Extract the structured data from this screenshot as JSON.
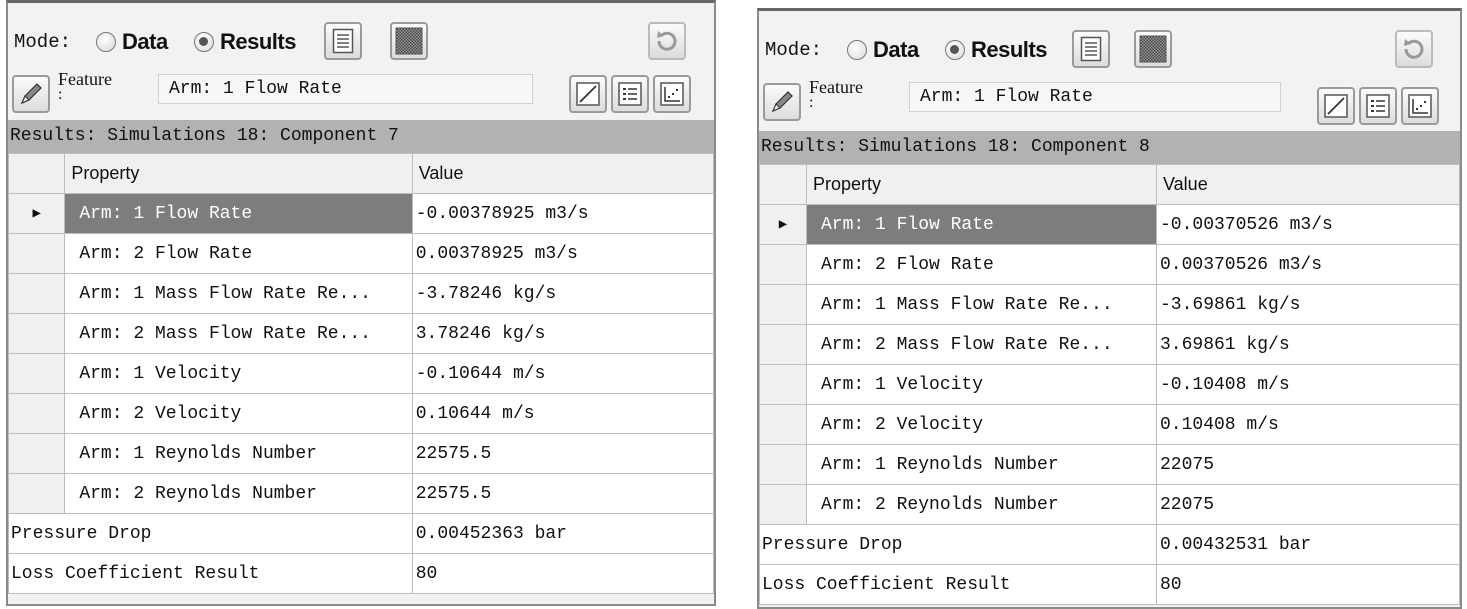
{
  "panels": [
    {
      "mode_label": "Mode:",
      "radio_data": "Data",
      "radio_results": "Results",
      "feature_label": "Feature",
      "feature_colon": ":",
      "feature_value": "Arm: 1 Flow Rate",
      "results_header": "Results: Simulations 18: Component 7",
      "col_property": "Property",
      "col_value": "Value",
      "rows": [
        {
          "property": "Arm: 1 Flow Rate",
          "value": "-0.00378925 m3/s"
        },
        {
          "property": "Arm: 2 Flow Rate",
          "value": "0.00378925 m3/s"
        },
        {
          "property": "Arm: 1 Mass Flow Rate Re...",
          "value": "-3.78246 kg/s"
        },
        {
          "property": "Arm: 2 Mass Flow Rate Re...",
          "value": "3.78246 kg/s"
        },
        {
          "property": "Arm: 1 Velocity",
          "value": "-0.10644 m/s"
        },
        {
          "property": "Arm: 2 Velocity",
          "value": "0.10644 m/s"
        },
        {
          "property": "Arm: 1 Reynolds Number",
          "value": "22575.5"
        },
        {
          "property": "Arm: 2 Reynolds Number",
          "value": "22575.5"
        }
      ],
      "extra_rows": [
        {
          "property": "Pressure Drop",
          "value": "0.00452363 bar"
        },
        {
          "property": "Loss Coefficient Result",
          "value": "80"
        }
      ]
    },
    {
      "mode_label": "Mode:",
      "radio_data": "Data",
      "radio_results": "Results",
      "feature_label": "Feature",
      "feature_colon": ":",
      "feature_value": "Arm: 1 Flow Rate",
      "results_header": "Results: Simulations 18: Component 8",
      "col_property": "Property",
      "col_value": "Value",
      "rows": [
        {
          "property": "Arm: 1 Flow Rate",
          "value": "-0.00370526 m3/s"
        },
        {
          "property": "Arm: 2 Flow Rate",
          "value": "0.00370526 m3/s"
        },
        {
          "property": "Arm: 1 Mass Flow Rate Re...",
          "value": "-3.69861 kg/s"
        },
        {
          "property": "Arm: 2 Mass Flow Rate Re...",
          "value": "3.69861 kg/s"
        },
        {
          "property": "Arm: 1 Velocity",
          "value": "-0.10408 m/s"
        },
        {
          "property": "Arm: 2 Velocity",
          "value": "0.10408 m/s"
        },
        {
          "property": "Arm: 1 Reynolds Number",
          "value": "22075"
        },
        {
          "property": "Arm: 2 Reynolds Number",
          "value": "22075"
        }
      ],
      "extra_rows": [
        {
          "property": "Pressure Drop",
          "value": "0.00432531 bar"
        },
        {
          "property": "Loss Coefficient Result",
          "value": "80"
        }
      ]
    }
  ],
  "selected_row_marker": "▶",
  "icons": {
    "toolbar": [
      "document-icon",
      "grid-pattern-icon",
      "refresh-icon"
    ],
    "feature": [
      "pencil-icon",
      "line-chart-icon",
      "list-icon",
      "scatter-plot-icon"
    ]
  },
  "colors": {
    "results_bar": "#b2b2b2",
    "selected_cell": "#7d7d7d"
  }
}
